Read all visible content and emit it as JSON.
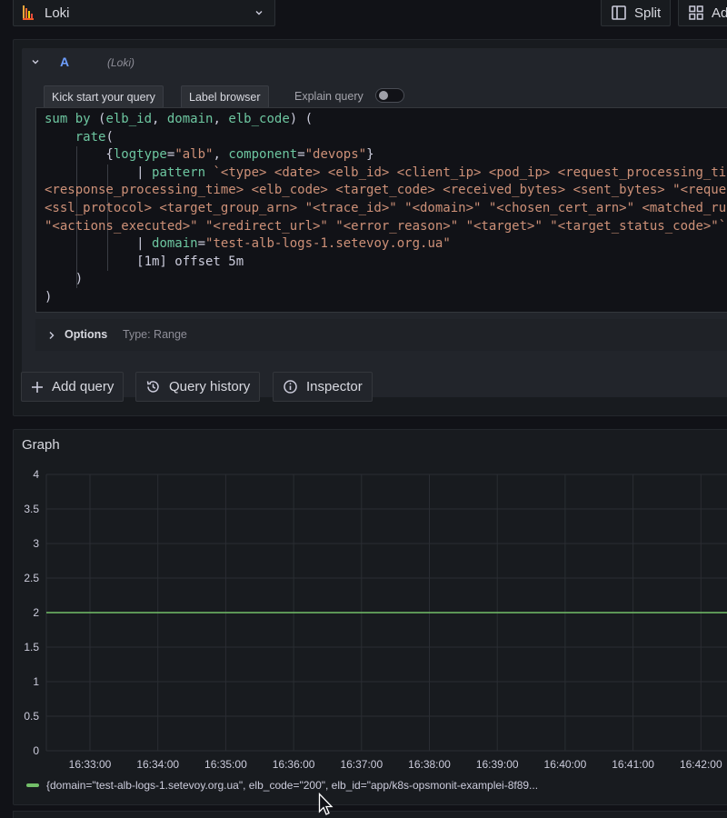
{
  "topbar": {
    "datasource": "Loki",
    "split_label": "Split",
    "add_label": "Add"
  },
  "query": {
    "ref_id": "A",
    "datasource_hint": "(Loki)",
    "kick_start_label": "Kick start your query",
    "label_browser_label": "Label browser",
    "explain_label": "Explain query",
    "options_label": "Options",
    "options_type": "Type: Range",
    "code_lines": [
      "sum by (elb_id, domain, elb_code) (",
      "    rate(",
      "        {logtype=\"alb\", component=\"devops\"}",
      "            | pattern `<type> <date> <elb_id> <client_ip> <pod_ip> <request_processing_time>",
      "<response_processing_time> <elb_code> <target_code> <received_bytes> <sent_bytes> \"<request>\" \"<user_agent>\" <ssl_cipher>",
      "<ssl_protocol> <target_group_arn> \"<trace_id>\" \"<domain>\" \"<chosen_cert_arn>\" <matched_rule_priority> <request_creation_time>",
      "\"<actions_executed>\" \"<redirect_url>\" \"<error_reason>\" \"<target>\" \"<target_status_code>\"`",
      "            | domain=\"test-alb-logs-1.setevoy.org.ua\"",
      "            [1m] offset 5m",
      "    )",
      ")"
    ]
  },
  "actions": {
    "add_query": "Add query",
    "query_history": "Query history",
    "inspector": "Inspector"
  },
  "graph": {
    "title": "Graph",
    "legend_label": "{domain=\"test-alb-logs-1.setevoy.org.ua\", elb_code=\"200\", elb_id=\"app/k8s-opsmonit-examplei-8f89..."
  },
  "chart_data": {
    "type": "line",
    "title": "Graph",
    "xlabel": "",
    "ylabel": "",
    "ylim": [
      0,
      4
    ],
    "yticks": [
      "0",
      "0.5",
      "1",
      "1.5",
      "2",
      "2.5",
      "3",
      "3.5",
      "4"
    ],
    "xticks": [
      "16:33:00",
      "16:34:00",
      "16:35:00",
      "16:36:00",
      "16:37:00",
      "16:38:00",
      "16:39:00",
      "16:40:00",
      "16:41:00",
      "16:42:00"
    ],
    "grid": true,
    "legend_position": "bottom",
    "series": [
      {
        "name": "{domain=\"test-alb-logs-1.setevoy.org.ua\", elb_code=\"200\", elb_id=\"app/k8s-opsmonit-examplei-8f89...",
        "color": "#73bf69",
        "x": [
          "16:32:20",
          "16:33:00",
          "16:34:00",
          "16:35:00",
          "16:36:00",
          "16:37:00",
          "16:38:00",
          "16:39:00",
          "16:40:00",
          "16:41:00",
          "16:42:00",
          "16:43:00"
        ],
        "values": [
          2,
          2,
          2,
          2,
          2,
          2,
          2,
          2,
          2,
          2,
          2,
          2
        ]
      }
    ]
  }
}
